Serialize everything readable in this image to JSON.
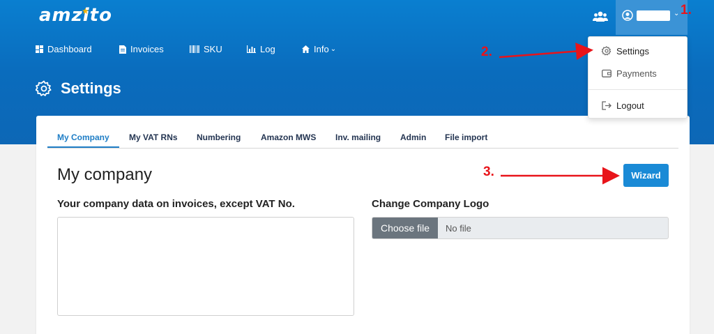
{
  "app": {
    "logo_text": "amzito"
  },
  "nav": {
    "items": [
      {
        "label": "Dashboard",
        "icon": "dashboard-icon"
      },
      {
        "label": "Invoices",
        "icon": "document-icon"
      },
      {
        "label": "SKU",
        "icon": "barcode-icon"
      },
      {
        "label": "Log",
        "icon": "bar-chart-icon"
      },
      {
        "label": "Info",
        "icon": "home-icon"
      }
    ]
  },
  "user_menu": {
    "items": [
      {
        "label": "Settings",
        "icon": "gear-icon"
      },
      {
        "label": "Payments",
        "icon": "wallet-icon"
      },
      {
        "label": "Logout",
        "icon": "logout-icon"
      }
    ]
  },
  "page": {
    "title": "Settings"
  },
  "tabs": [
    "My Company",
    "My VAT RNs",
    "Numbering",
    "Amazon MWS",
    "Inv. mailing",
    "Admin",
    "File import"
  ],
  "active_tab": "My Company",
  "content": {
    "section_title": "My company",
    "wizard_label": "Wizard",
    "company_data_label": "Your company data on invoices, except VAT No.",
    "logo_label": "Change Company Logo",
    "choose_file_label": "Choose file",
    "no_file_text": "No file"
  },
  "annotations": {
    "step1": "1.",
    "step2": "2.",
    "step3": "3."
  },
  "colors": {
    "brand_blue": "#0a6cbd",
    "accent": "#1a8ad6",
    "annotation_red": "#e8141a",
    "star": "#f5b400"
  }
}
